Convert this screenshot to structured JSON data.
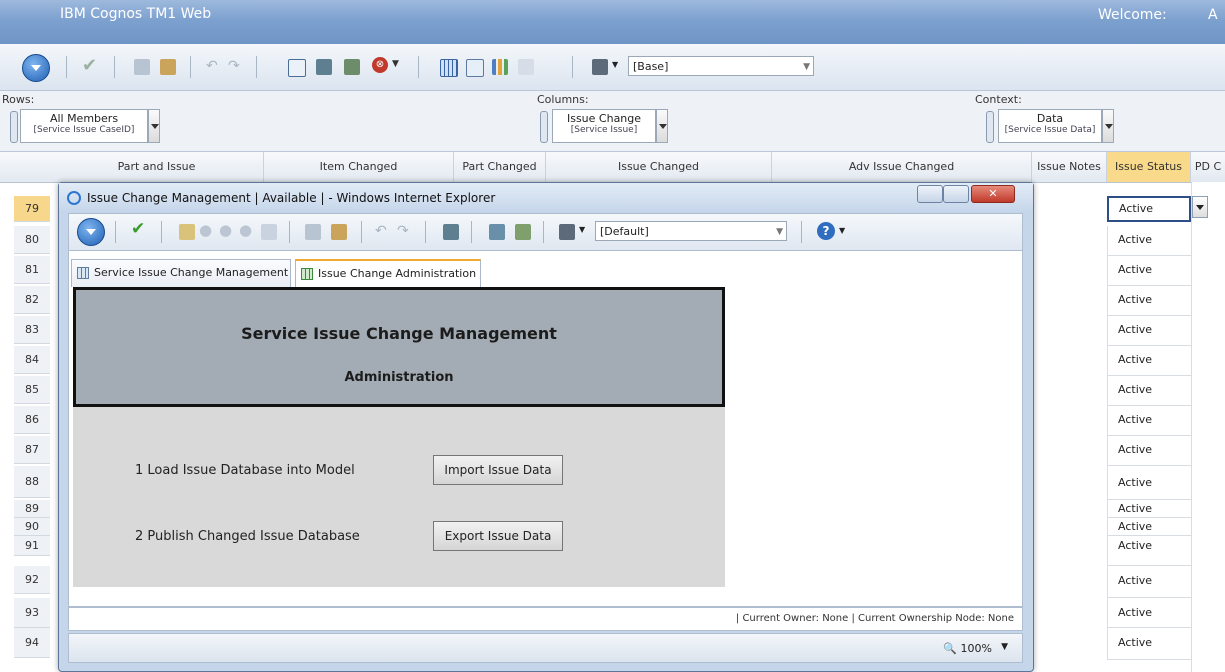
{
  "app": {
    "title": "IBM Cognos TM1 Web",
    "welcome": "Welcome:",
    "welcome_user": "A"
  },
  "toolbar": {
    "subset": "[Base]"
  },
  "dims": {
    "rows_label": "Rows:",
    "rows_name": "All Members",
    "rows_sub": "[Service Issue CaseID]",
    "columns_label": "Columns:",
    "columns_name": "Issue Change",
    "columns_sub": "[Service Issue]",
    "context_label": "Context:",
    "context_name": "Data",
    "context_sub": "[Service Issue Data]"
  },
  "grid": {
    "headers": [
      "Part and Issue",
      "Item Changed",
      "Part Changed",
      "Issue Changed",
      "Adv Issue Changed",
      "Issue Notes",
      "Issue Status",
      "PD C"
    ],
    "rows": [
      {
        "num": "79",
        "status": "Active"
      },
      {
        "num": "80",
        "status": "Active"
      },
      {
        "num": "81",
        "status": "Active"
      },
      {
        "num": "82",
        "status": "Active"
      },
      {
        "num": "83",
        "status": "Active"
      },
      {
        "num": "84",
        "status": "Active"
      },
      {
        "num": "85",
        "status": "Active"
      },
      {
        "num": "86",
        "status": "Active"
      },
      {
        "num": "87",
        "status": "Active"
      },
      {
        "num": "88",
        "status": "Active"
      },
      {
        "num": "89",
        "status": "Active"
      },
      {
        "num": "90",
        "status": "Active"
      },
      {
        "num": "91",
        "status": "Active"
      },
      {
        "num": "92",
        "status": "Active"
      },
      {
        "num": "93",
        "status": "Active"
      },
      {
        "num": "94",
        "status": "Active"
      }
    ]
  },
  "popup": {
    "title": "Issue Change Management | Available | - Windows Internet Explorer",
    "subset": "[Default]",
    "tabs": [
      "Service Issue Change Management",
      "Issue Change Administration"
    ],
    "banner_title": "Service Issue Change Management",
    "banner_sub": "Administration",
    "step1": "1 Load Issue Database into Model",
    "step1_button": "Import Issue Data",
    "step2": "2 Publish Changed Issue Database",
    "step2_button": "Export Issue Data",
    "status": "| Current Owner: None | Current Ownership Node: None",
    "zoom": "100%"
  }
}
